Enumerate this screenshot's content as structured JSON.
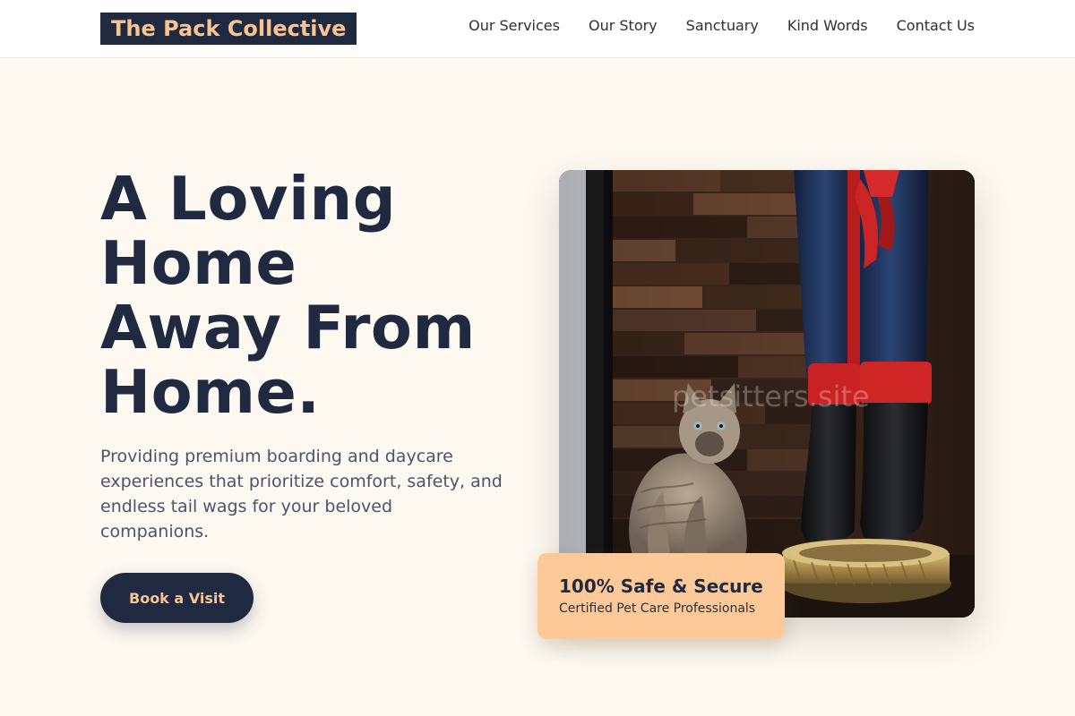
{
  "header": {
    "logo_text": "The Pack Collective",
    "nav": [
      "Our Services",
      "Our Story",
      "Sanctuary",
      "Kind Words",
      "Contact Us"
    ]
  },
  "hero": {
    "title_lines": [
      "A Loving",
      "Home",
      "Away From",
      "Home."
    ],
    "subtitle": "Providing premium boarding and daycare experiences that prioritize comfort, safety, and endless tail wags for your beloved companions.",
    "cta_label": "Book a Visit",
    "image_watermark": "petsitters.site",
    "badge": {
      "title": "100% Safe & Secure",
      "subtitle": "Certified Pet Care Professionals"
    }
  },
  "colors": {
    "brand_navy": "#1f2a40",
    "accent_peach": "#f9c48f",
    "badge_peach": "#fdc999",
    "page_bg": "#fdf9f1"
  }
}
